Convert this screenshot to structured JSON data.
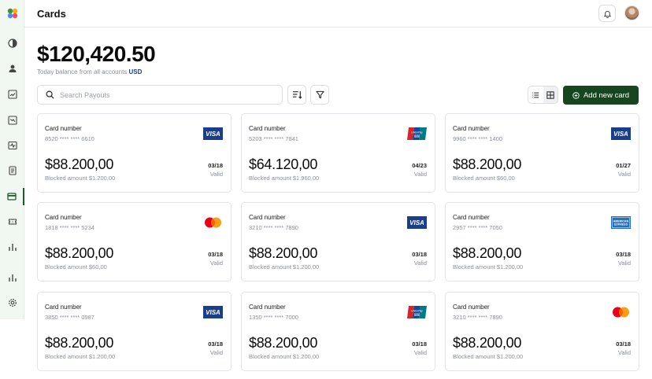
{
  "header": {
    "title": "Cards"
  },
  "balance": {
    "amount": "$120,420.50",
    "caption": "Today balance from all accounts",
    "currency": "USD"
  },
  "search": {
    "placeholder": "Search Payouts"
  },
  "toolbar": {
    "add_label": "Add new card"
  },
  "colors": {
    "accent": "#17451f",
    "sidebar_bg": "#f1f8f2",
    "visa_blue": "#1a3e8c",
    "link_blue": "#1a3e8c"
  },
  "sidebar": {
    "items": [
      {
        "icon": "contrast-icon"
      },
      {
        "icon": "user-icon"
      },
      {
        "icon": "trend-chart-icon"
      },
      {
        "icon": "trend-down-icon"
      },
      {
        "icon": "pulse-icon"
      },
      {
        "icon": "document-icon"
      },
      {
        "icon": "card-icon",
        "active": true
      },
      {
        "icon": "ticket-icon"
      },
      {
        "icon": "bar-chart-icon"
      },
      {
        "icon": "bar-chart-icon"
      },
      {
        "icon": "settings-icon"
      }
    ]
  },
  "cards": [
    {
      "label": "Card number",
      "number": "8520 **** **** 6610",
      "amount": "$88.200,00",
      "blocked": "Blocked amount $1.200,00",
      "expiry": "03/18",
      "status": "Valid",
      "brand": "visa"
    },
    {
      "label": "Card number",
      "number": "5203 **** **** 7841",
      "amount": "$64.120,00",
      "blocked": "Blocked amount $1.960,00",
      "expiry": "04/23",
      "status": "Valid",
      "brand": "unionpay"
    },
    {
      "label": "Card number",
      "number": "9960 **** **** 1400",
      "amount": "$88.200,00",
      "blocked": "Blocked amount $60,00",
      "expiry": "01/27",
      "status": "Valid",
      "brand": "visa"
    },
    {
      "label": "Card number",
      "number": "1818 **** **** 5234",
      "amount": "$88.200,00",
      "blocked": "Blocked amount $60,00",
      "expiry": "03/18",
      "status": "Valid",
      "brand": "mastercard"
    },
    {
      "label": "Card number",
      "number": "3210 **** **** 7890",
      "amount": "$88.200,00",
      "blocked": "Blocked amount $1.200,00",
      "expiry": "03/18",
      "status": "Valid",
      "brand": "visa"
    },
    {
      "label": "Card number",
      "number": "2957 **** **** 7050",
      "amount": "$88.200,00",
      "blocked": "Blocked amount $1.200,00",
      "expiry": "03/18",
      "status": "Valid",
      "brand": "amex"
    },
    {
      "label": "Card number",
      "number": "3850 **** **** 0987",
      "amount": "$88.200,00",
      "blocked": "Blocked amount $1.200,00",
      "expiry": "03/18",
      "status": "Valid",
      "brand": "visa"
    },
    {
      "label": "Card number",
      "number": "1350 **** **** 7000",
      "amount": "$88.200,00",
      "blocked": "Blocked amount $1.200,00",
      "expiry": "03/18",
      "status": "Valid",
      "brand": "unionpay"
    },
    {
      "label": "Card number",
      "number": "3210 **** **** 7890",
      "amount": "$88.200,00",
      "blocked": "Blocked amount $1.200,00",
      "expiry": "03/18",
      "status": "Valid",
      "brand": "mastercard"
    }
  ],
  "brand_marks": {
    "visa": "VISA",
    "unionpay": "UnionPay",
    "amex": "AMERICAN EXPRESS"
  }
}
